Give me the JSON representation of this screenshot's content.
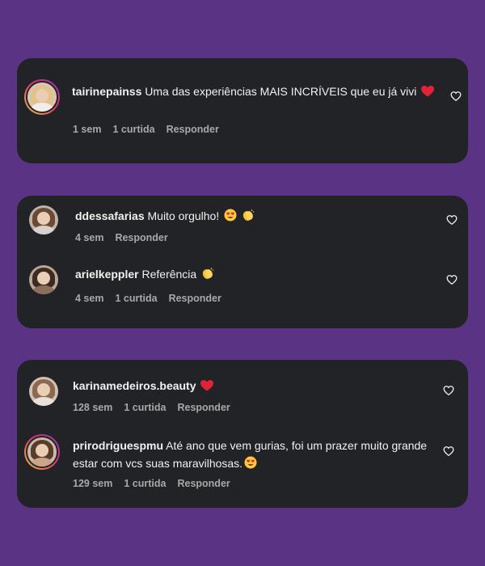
{
  "threads": [
    {
      "comments": [
        {
          "username": "tairinepainss",
          "text": "Uma das experiências MAIS INCRÍVEIS que eu já vivi",
          "emoji_icons": [
            "red-heart-icon"
          ],
          "time": "1 sem",
          "likes": "1 curtida",
          "reply": "Responder"
        }
      ]
    },
    {
      "comments": [
        {
          "username": "ddessafarias",
          "text": "Muito orgulho!",
          "emoji_icons": [
            "heart-eyes-emoji-icon",
            "clapping-hands-icon"
          ],
          "time": "4 sem",
          "reply": "Responder"
        },
        {
          "username": "arielkeppler",
          "text": "Referência",
          "emoji_icons": [
            "clapping-hands-icon"
          ],
          "time": "4 sem",
          "likes": "1 curtida",
          "reply": "Responder"
        }
      ]
    },
    {
      "comments": [
        {
          "username": "karinamedeiros.beauty",
          "text": "",
          "emoji_icons": [
            "red-heart-icon"
          ],
          "time": "128 sem",
          "likes": "1 curtida",
          "reply": "Responder"
        },
        {
          "username": "prirodriguespmu",
          "text": "Até ano que vem gurias, foi um prazer muito grande estar com vcs suas maravilhosas.",
          "emoji_icons": [
            "heart-eyes-emoji-icon"
          ],
          "time": "129 sem",
          "likes": "1 curtida",
          "reply": "Responder"
        }
      ]
    }
  ],
  "colors": {
    "background": "#5b3384",
    "card": "#222326",
    "text": "#f1f1f1",
    "meta": "#a8a8a8",
    "heart": "#e0233a"
  }
}
